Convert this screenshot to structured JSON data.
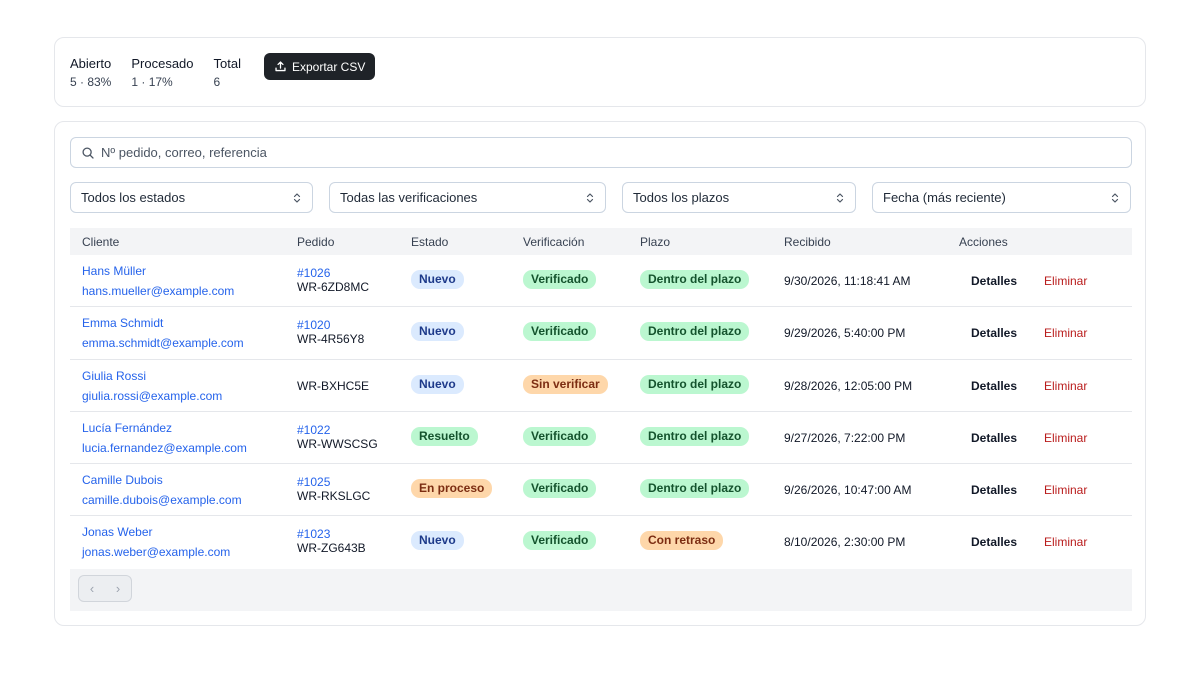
{
  "stats": {
    "open_label": "Abierto",
    "open_value": "5 · 83%",
    "processed_label": "Procesado",
    "processed_value": "1 · 17%",
    "total_label": "Total",
    "total_value": "6"
  },
  "export_label": "Exportar CSV",
  "search": {
    "placeholder": "Nº pedido, correo, referencia"
  },
  "filters": {
    "status": "Todos los estados",
    "verification": "Todas las verificaciones",
    "deadline": "Todos los plazos",
    "sort": "Fecha (más reciente)"
  },
  "columns": {
    "customer": "Cliente",
    "order": "Pedido",
    "status": "Estado",
    "verification": "Verificación",
    "deadline": "Plazo",
    "received": "Recibido",
    "actions": "Acciones"
  },
  "rows": [
    {
      "name": "Hans Müller",
      "email": "hans.mueller@example.com",
      "order_id": "#1026",
      "ref": "WR-6ZD8MC",
      "status": "Nuevo",
      "verification": "Verificado",
      "deadline": "Dentro del plazo",
      "received": "9/30/2026, 11:18:41 AM"
    },
    {
      "name": "Emma Schmidt",
      "email": "emma.schmidt@example.com",
      "order_id": "#1020",
      "ref": "WR-4R56Y8",
      "status": "Nuevo",
      "verification": "Verificado",
      "deadline": "Dentro del plazo",
      "received": "9/29/2026, 5:40:00 PM"
    },
    {
      "name": "Giulia Rossi",
      "email": "giulia.rossi@example.com",
      "order_id": "",
      "ref": "WR-BXHC5E",
      "status": "Nuevo",
      "verification": "Sin verificar",
      "deadline": "Dentro del plazo",
      "received": "9/28/2026, 12:05:00 PM"
    },
    {
      "name": "Lucía Fernández",
      "email": "lucia.fernandez@example.com",
      "order_id": "#1022",
      "ref": "WR-WWSCSG",
      "status": "Resuelto",
      "verification": "Verificado",
      "deadline": "Dentro del plazo",
      "received": "9/27/2026, 7:22:00 PM"
    },
    {
      "name": "Camille Dubois",
      "email": "camille.dubois@example.com",
      "order_id": "#1025",
      "ref": "WR-RKSLGC",
      "status": "En proceso",
      "verification": "Verificado",
      "deadline": "Dentro del plazo",
      "received": "9/26/2026, 10:47:00 AM"
    },
    {
      "name": "Jonas Weber",
      "email": "jonas.weber@example.com",
      "order_id": "#1023",
      "ref": "WR-ZG643B",
      "status": "Nuevo",
      "verification": "Verificado",
      "deadline": "Con retraso",
      "received": "8/10/2026, 2:30:00 PM"
    }
  ],
  "actions": {
    "details": "Detalles",
    "delete": "Eliminar"
  },
  "pager": {
    "prev": "‹",
    "next": "›"
  },
  "colors": {
    "link": "#2563eb",
    "delete": "#b91c1c",
    "export_bg": "#1f2328"
  }
}
